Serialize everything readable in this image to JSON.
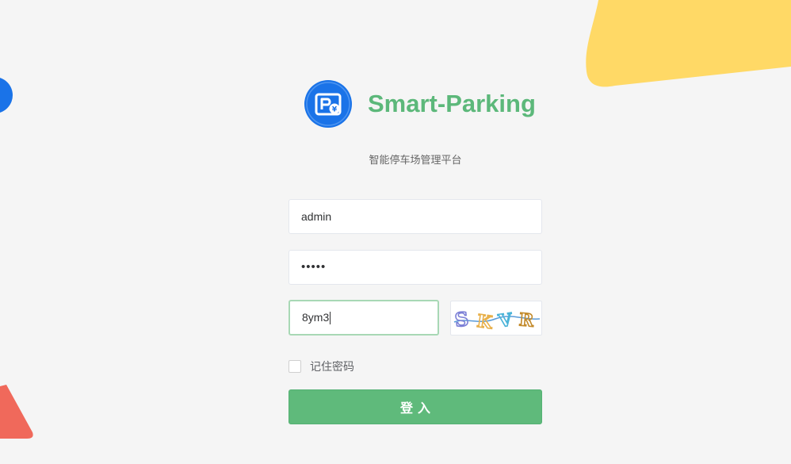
{
  "app": {
    "title": "Smart-Parking",
    "subtitle": "智能停车场管理平台",
    "brand_color": "#5cb87a",
    "logo_icon": "parking-logo-icon",
    "logo_color": "#1a73e8"
  },
  "form": {
    "username": {
      "value": "admin"
    },
    "password": {
      "value": "•••••"
    },
    "captcha": {
      "value": "8ym3",
      "image_text": [
        "S",
        "K",
        "V",
        "R"
      ],
      "image_colors": [
        "#7b7fd6",
        "#e8b04a",
        "#4ab3d8",
        "#c38a2a"
      ]
    },
    "remember": {
      "label": "记住密码",
      "checked": false
    },
    "submit_label": "登入"
  },
  "decorations": {
    "yellow": "#ffd966",
    "blue": "#1a73e8",
    "red": "#f0695b"
  }
}
